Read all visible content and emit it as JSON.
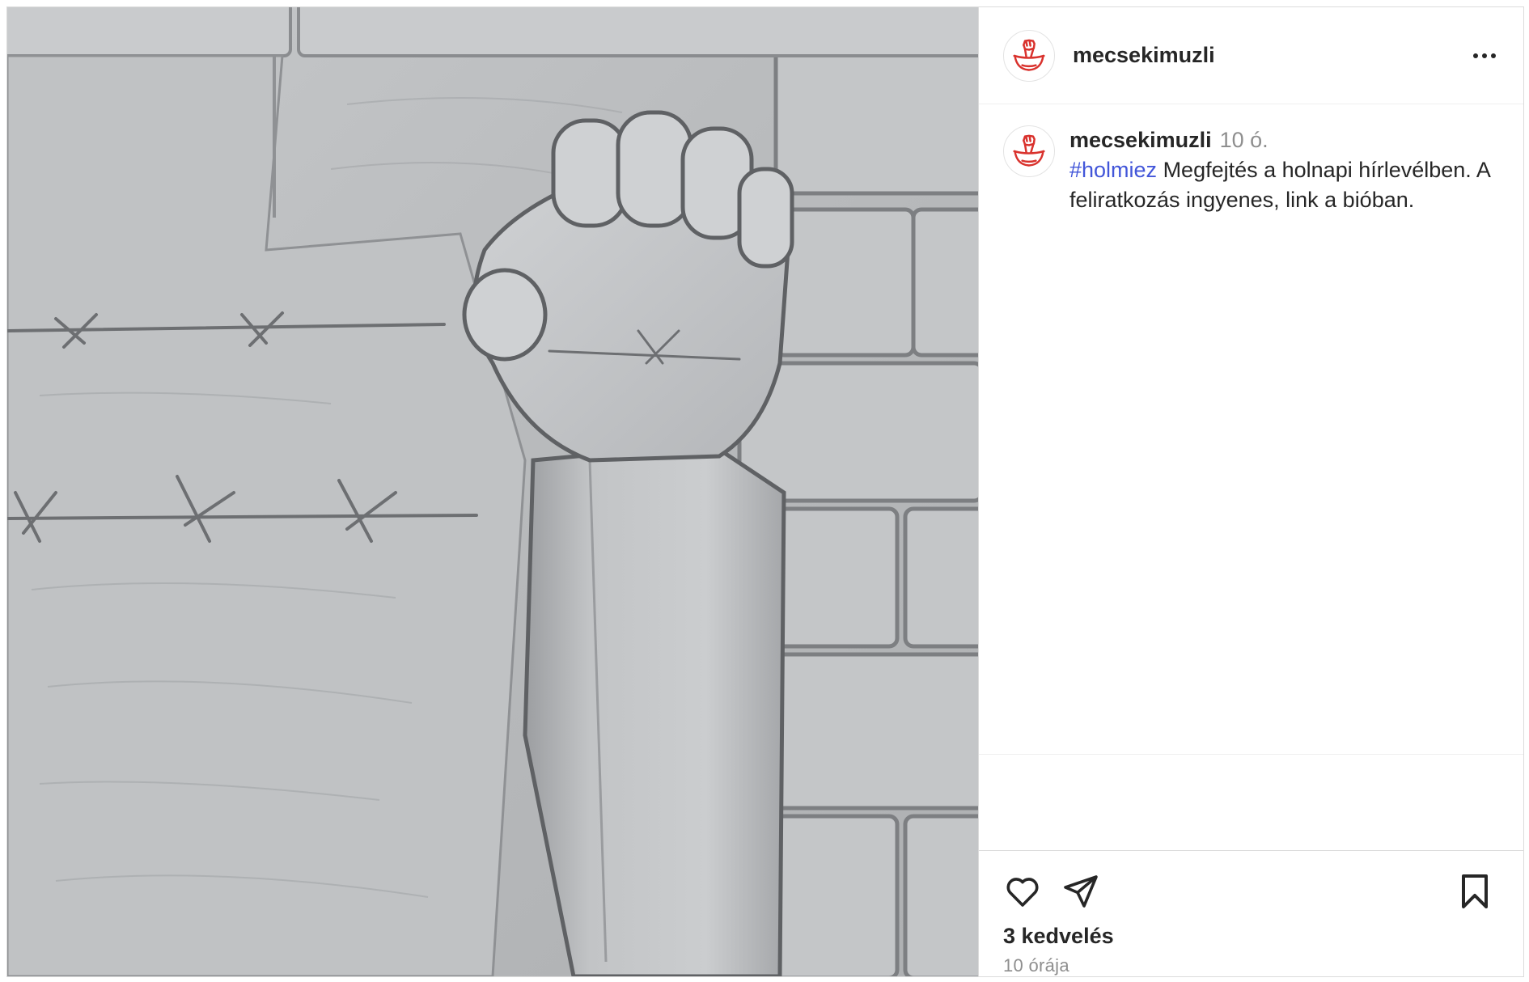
{
  "post": {
    "username": "mecsekimuzli",
    "menu_icon": "more-horizontal-icon",
    "caption": {
      "username": "mecsekimuzli",
      "timestamp": "10 ó.",
      "hashtag": "#holmiez",
      "text": " Megfejtés a holnapi hírlevélben. A feliratkozás ingyenes, link a bióban."
    },
    "image": {
      "subject": "stone-relief-raised-fist-photo"
    },
    "actions": {
      "like_icon": "heart-icon",
      "share_icon": "paper-plane-icon",
      "save_icon": "bookmark-icon"
    },
    "likes": "3 kedvelés",
    "posted": "10 órája"
  },
  "colors": {
    "text": "#262626",
    "muted": "#8e8e8e",
    "hashtag": "#4256d9",
    "brand_red": "#d9322d",
    "border": "#dbdbdb"
  }
}
